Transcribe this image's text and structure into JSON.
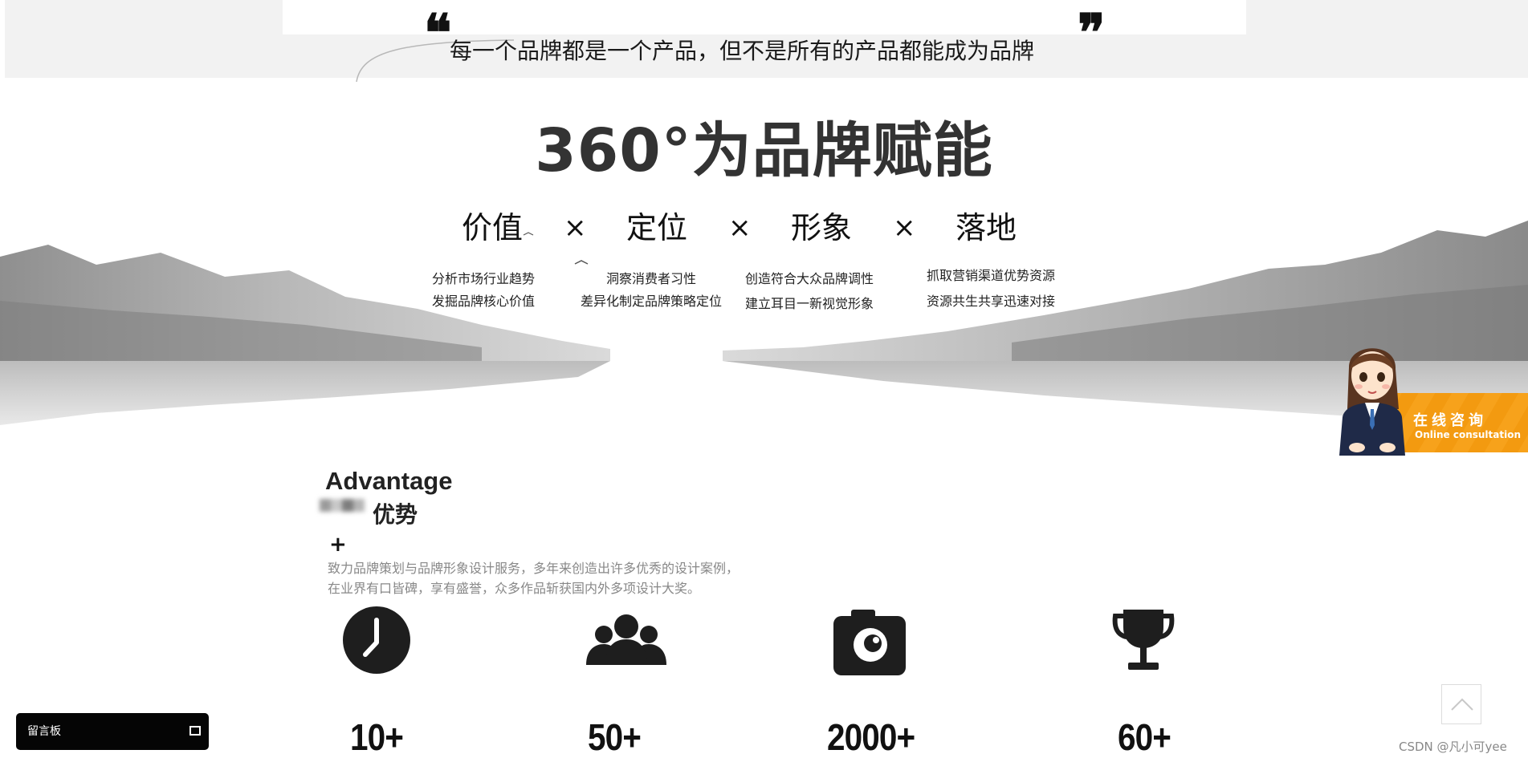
{
  "quote": {
    "open_mark": "❝",
    "close_mark": "❞",
    "text": "每一个品牌都是一个产品，但不是所有的产品都能成为品牌"
  },
  "hero": {
    "title": "360°为品牌赋能",
    "pillars": [
      {
        "label": "价值",
        "lines": [
          "分析市场行业趋势",
          "发掘品牌核心价值"
        ]
      },
      {
        "label": "定位",
        "lines": [
          "洞察消费者习性",
          "差异化制定品牌策略定位"
        ]
      },
      {
        "label": "形象",
        "lines": [
          "创造符合大众品牌调性",
          "建立耳目一新视觉形象"
        ]
      },
      {
        "label": "落地",
        "lines": [
          "抓取营销渠道优势资源",
          "资源共生共享迅速对接"
        ]
      }
    ],
    "separator": "×"
  },
  "advantage": {
    "title_en": "Advantage",
    "title_cn": "优势",
    "plus": "+",
    "description_lines": [
      "致力品牌策划与品牌形象设计服务，多年来创造出许多优秀的设计案例，",
      "在业界有口皆碑，享有盛誉，众多作品斩获国内外多项设计大奖。"
    ],
    "stats": [
      {
        "icon": "clock-icon",
        "value": "10+"
      },
      {
        "icon": "team-icon",
        "value": "50+"
      },
      {
        "icon": "camera-icon",
        "value": "2000+"
      },
      {
        "icon": "trophy-icon",
        "value": "60+"
      }
    ]
  },
  "consult": {
    "label_cn": "在线咨询",
    "label_en": "Online consultation"
  },
  "message_board": {
    "label": "留言板"
  },
  "watermark": "CSDN @凡小可yee",
  "colors": {
    "accent_orange": "#f7a21b",
    "dark": "#222222",
    "muted_text": "#888888"
  }
}
